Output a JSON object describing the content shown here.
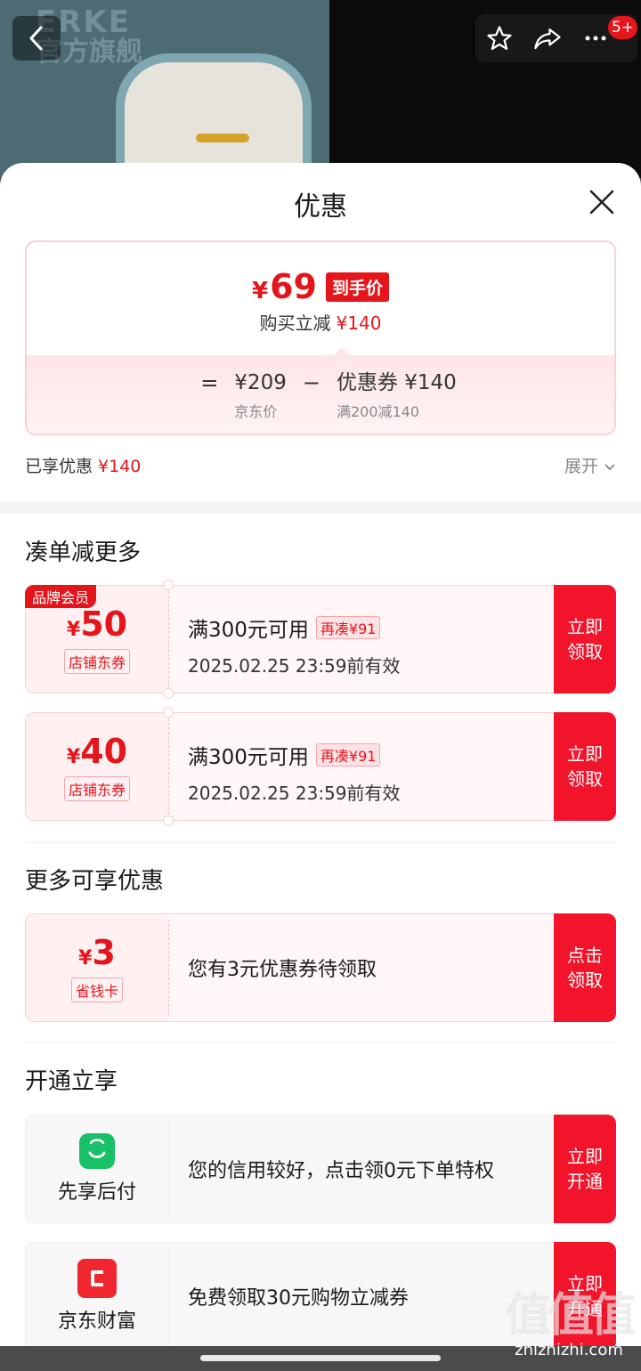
{
  "header": {
    "brand_logo_line1": "ERKE",
    "brand_logo_line2": "官方旗舰",
    "notification_badge": "5+",
    "icons": [
      "back-icon",
      "star-icon",
      "share-icon",
      "more-icon"
    ]
  },
  "sheet": {
    "title": "优惠",
    "price": {
      "currency": "¥",
      "final_price": "69",
      "final_label": "到手价",
      "discount_text": "购买立减",
      "discount_value": "¥140",
      "eq": "=",
      "minus": "−",
      "jd_price": "¥209",
      "jd_price_label": "京东价",
      "coupon_text": "优惠券 ¥140",
      "coupon_rule": "满200减140"
    },
    "enjoyed_label": "已享优惠",
    "enjoyed_value": "¥140",
    "expand_label": "展开"
  },
  "section_bundle": {
    "title": "凑单减更多",
    "coupons": [
      {
        "member_tag": "品牌会员",
        "currency": "¥",
        "amount": "50",
        "type": "店铺东券",
        "condition": "满300元可用",
        "more": "再凑¥91",
        "validity": "2025.02.25 23:59前有效",
        "btn_line1": "立即",
        "btn_line2": "领取"
      },
      {
        "currency": "¥",
        "amount": "40",
        "type": "店铺东券",
        "condition": "满300元可用",
        "more": "再凑¥91",
        "validity": "2025.02.25 23:59前有效",
        "btn_line1": "立即",
        "btn_line2": "领取"
      }
    ]
  },
  "section_more": {
    "title": "更多可享优惠",
    "card": {
      "currency": "¥",
      "amount": "3",
      "type": "省钱卡",
      "text": "您有3元优惠券待领取",
      "btn_line1": "点击",
      "btn_line2": "领取"
    }
  },
  "section_open": {
    "title": "开通立享",
    "items": [
      {
        "label": "先享后付",
        "text": "您的信用较好，点击领0元下单特权",
        "btn_line1": "立即",
        "btn_line2": "开通"
      },
      {
        "label": "京东财富",
        "text": "免费领取30元购物立减券",
        "btn_line1": "立即",
        "btn_line2": "开通"
      }
    ]
  },
  "watermark": {
    "big": "值值值",
    "small": "zhizhizhi.com"
  },
  "colors": {
    "accent_red": "#e5151c",
    "button_red": "#f2142b",
    "pay_green": "#18c067"
  }
}
